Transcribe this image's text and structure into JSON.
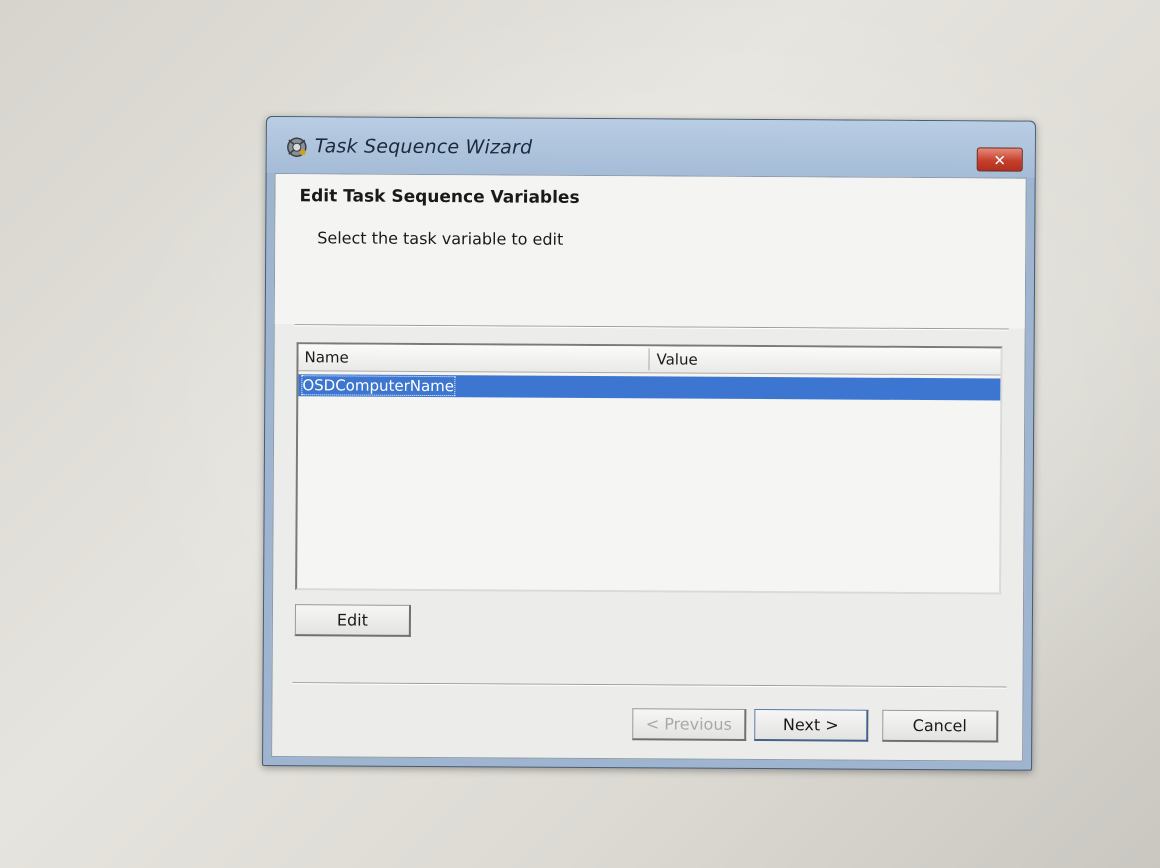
{
  "window": {
    "title": "Task Sequence Wizard",
    "close_label": "✕",
    "accent_color": "#3d76d1"
  },
  "page": {
    "heading": "Edit Task Sequence Variables",
    "instruction": "Select the task variable to edit"
  },
  "variables_list": {
    "columns": [
      "Name",
      "Value"
    ],
    "rows": [
      {
        "name": "OSDComputerName",
        "value": "",
        "selected": true
      }
    ]
  },
  "buttons": {
    "edit": "Edit",
    "previous": "< Previous",
    "next": "Next >",
    "cancel": "Cancel"
  }
}
